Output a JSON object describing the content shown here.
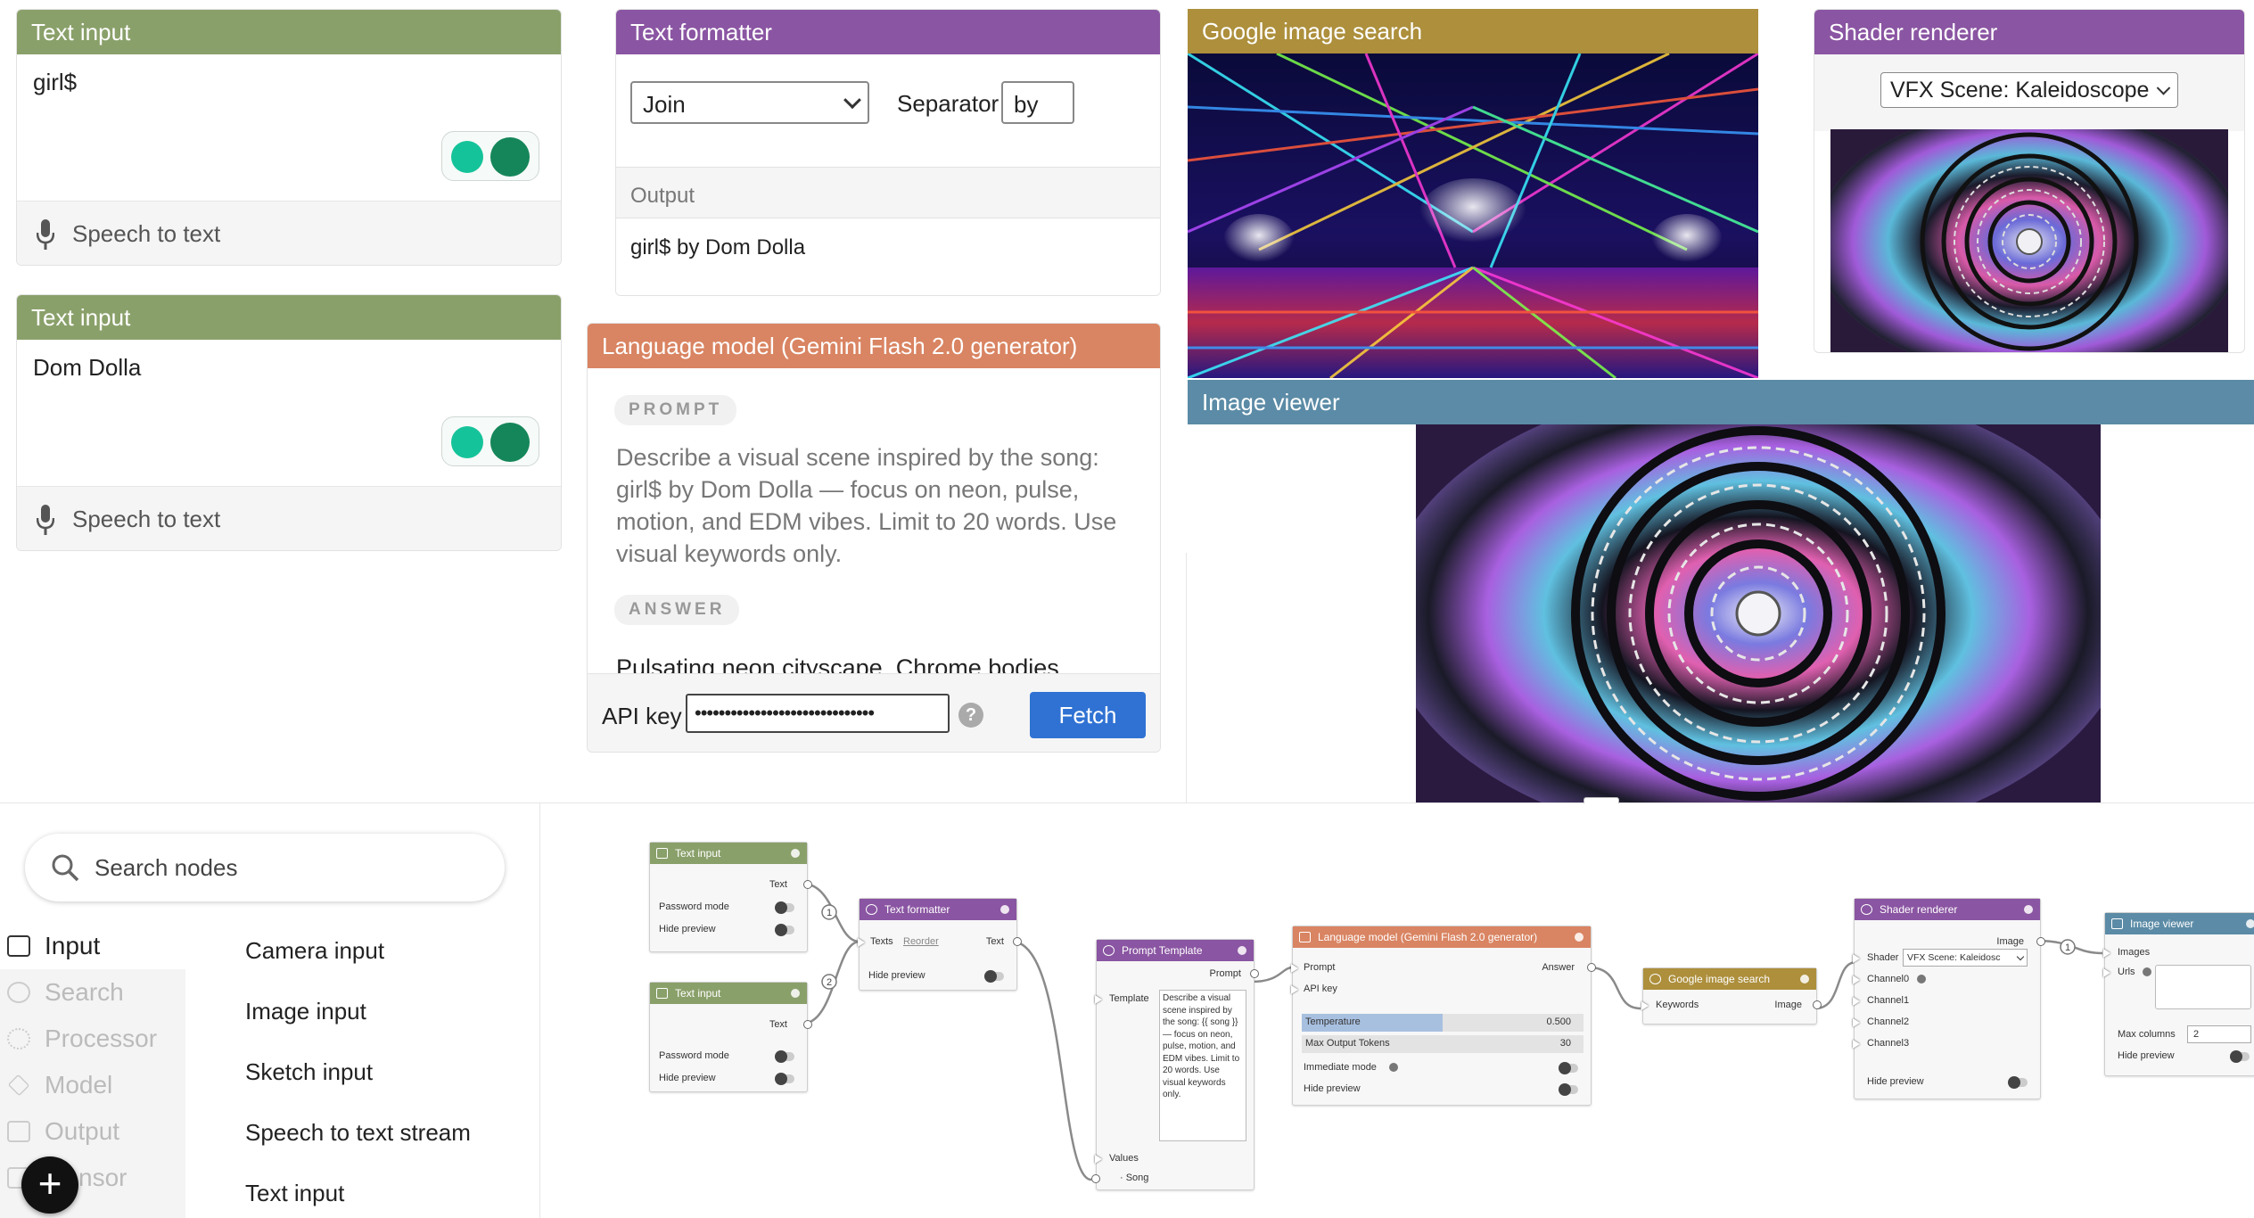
{
  "text_input_1": {
    "title": "Text input",
    "value": "girl$",
    "speech_label": "Speech to text"
  },
  "text_input_2": {
    "title": "Text input",
    "value": "Dom Dolla",
    "speech_label": "Speech to text"
  },
  "text_formatter": {
    "title": "Text formatter",
    "mode": "Join",
    "separator_label": "Separator",
    "separator_value": "by",
    "output_label": "Output",
    "output_value": "girl$ by Dom Dolla"
  },
  "language_model": {
    "title": "Language model (Gemini Flash 2.0 generator)",
    "prompt_label": "PROMPT",
    "prompt_text": "Describe a visual scene inspired by the song: girl$ by Dom Dolla — focus on neon, pulse, motion, and EDM vibes. Limit to 20 words. Use visual keywords only.",
    "answer_label": "ANSWER",
    "answer_text": "Pulsating neon cityscape. Chrome bodies",
    "api_key_label": "API key",
    "api_key_value": "••••••••••••••••••••••••••••••",
    "help_symbol": "?",
    "fetch_label": "Fetch"
  },
  "google_image_search": {
    "title": "Google image search",
    "image_icon": "laser-stage-image"
  },
  "shader_renderer": {
    "title": "Shader renderer",
    "scene": "VFX Scene: Kaleidoscope",
    "image_icon": "kaleidoscope-image"
  },
  "image_viewer": {
    "title": "Image viewer",
    "image_icon": "kaleidoscope-image"
  },
  "sidebar": {
    "search_placeholder": "Search nodes",
    "categories": [
      {
        "label": "Input",
        "icon": "input-icon"
      },
      {
        "label": "Search",
        "icon": "search-icon"
      },
      {
        "label": "Processor",
        "icon": "gear-icon"
      },
      {
        "label": "Model",
        "icon": "sparkle-icon"
      },
      {
        "label": "Output",
        "icon": "output-icon"
      },
      {
        "label": "nsor",
        "icon": "bracket-icon"
      }
    ],
    "nodes": [
      "Camera input",
      "Image input",
      "Sketch input",
      "Speech to text stream",
      "Text input"
    ],
    "add_symbol": "+"
  },
  "graph": {
    "text_input_1": {
      "title": "Text input",
      "out": "Text",
      "password": "Password mode",
      "hide": "Hide preview"
    },
    "text_input_2": {
      "title": "Text input",
      "out": "Text",
      "password": "Password mode",
      "hide": "Hide preview"
    },
    "formatter": {
      "title": "Text formatter",
      "texts": "Texts",
      "reorder": "Reorder",
      "out": "Text",
      "hide": "Hide preview"
    },
    "prompt_template": {
      "title": "Prompt Template",
      "out": "Prompt",
      "template_label": "Template",
      "template_text": "Describe a visual scene inspired by the song: {{ song }} — focus on neon, pulse, motion, and EDM vibes. Limit to 20 words. Use visual keywords only.",
      "values": "Values",
      "song": "· Song"
    },
    "llm": {
      "title": "Language model (Gemini Flash 2.0 generator)",
      "prompt": "Prompt",
      "answer": "Answer",
      "api_key": "API key",
      "temperature_label": "Temperature",
      "temperature_value": "0.500",
      "temperature_fill": 0.5,
      "max_tokens_label": "Max Output Tokens",
      "max_tokens_value": "30",
      "immediate": "Immediate mode",
      "hide": "Hide preview"
    },
    "google": {
      "title": "Google image search",
      "keywords": "Keywords",
      "image": "Image"
    },
    "shader": {
      "title": "Shader renderer",
      "image": "Image",
      "shader_label": "Shader",
      "shader_value": "VFX Scene: Kaleidosc",
      "channels": [
        "Channel0",
        "Channel1",
        "Channel2",
        "Channel3"
      ],
      "hide": "Hide preview"
    },
    "viewer": {
      "title": "Image viewer",
      "images": "Images",
      "urls": "Urls",
      "max_columns_label": "Max columns",
      "max_columns_value": "2",
      "hide": "Hide preview"
    },
    "edge_labels": [
      "1",
      "2",
      "1"
    ]
  },
  "colors": {
    "green": "#8aa06a",
    "purple": "#8a55a2",
    "gold": "#ad8f3c",
    "orange": "#d98462",
    "blue": "#5b8ba6",
    "fetch": "#2f72d3"
  }
}
